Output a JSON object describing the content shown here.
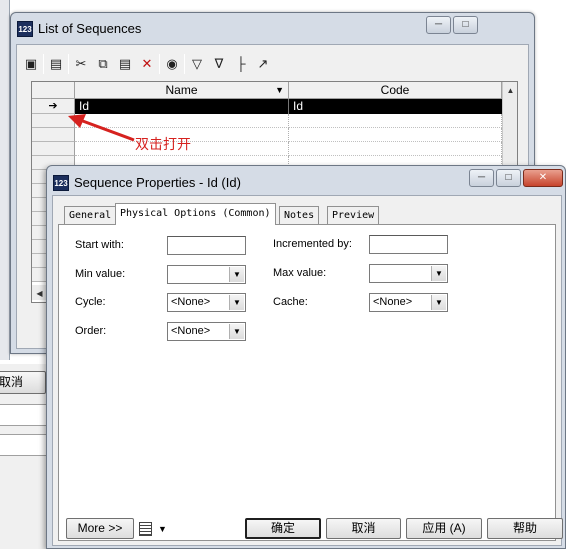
{
  "background": {
    "cancel_label": "取消"
  },
  "list_window": {
    "title": "List of Sequences",
    "app_icon": "123",
    "icons": [
      "properties-icon",
      "add-row-icon",
      "cut-icon",
      "copy-icon",
      "paste-icon",
      "delete-icon",
      "find-icon",
      "filter-icon",
      "clear-filter-icon",
      "hierarchy-icon",
      "open-icon"
    ],
    "columns": [
      "Name",
      "Code"
    ],
    "rows": [
      {
        "name": "Id",
        "code": "Id"
      }
    ],
    "annotation": "双击打开",
    "accent": "#d6221f"
  },
  "dialog": {
    "title": "Sequence Properties - Id (Id)",
    "app_icon": "123",
    "tabs": [
      "General",
      "Physical Options (Common)",
      "Notes",
      "Preview"
    ],
    "active_tab": "Physical Options (Common)",
    "fields": {
      "start_with": {
        "label": "Start with:",
        "value": ""
      },
      "incremented_by": {
        "label": "Incremented by:",
        "value": ""
      },
      "min_value": {
        "label": "Min value:",
        "value": ""
      },
      "max_value": {
        "label": "Max value:",
        "value": ""
      },
      "cycle": {
        "label": "Cycle:",
        "value": "<None>"
      },
      "cache": {
        "label": "Cache:",
        "value": "<None>"
      },
      "order": {
        "label": "Order:",
        "value": "<None>"
      }
    },
    "buttons": {
      "more": "More >>",
      "ok": "确定",
      "cancel": "取消",
      "apply": "应用 (A)",
      "help": "帮助"
    }
  }
}
